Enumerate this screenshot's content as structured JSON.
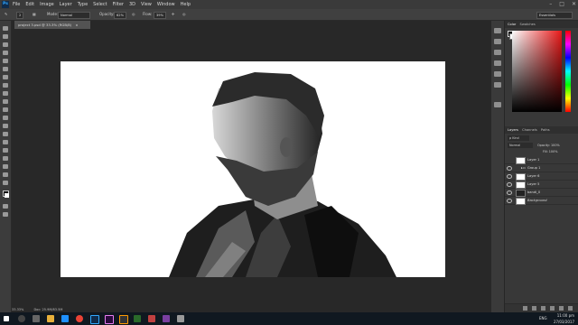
{
  "app": {
    "logo": "Ps"
  },
  "menu": [
    "File",
    "Edit",
    "Image",
    "Layer",
    "Type",
    "Select",
    "Filter",
    "3D",
    "View",
    "Window",
    "Help"
  ],
  "window_controls": [
    "–",
    "□",
    "✕"
  ],
  "options_bar": {
    "brush_size": "2",
    "mode_label": "Mode:",
    "mode_value": "Normal",
    "opacity_label": "Opacity:",
    "opacity_value": "62%",
    "flow_label": "Flow:",
    "flow_value": "39%",
    "workspace": "Essentials"
  },
  "document_tab": {
    "title": "project 3.psd @ 33.3% (RGB/8)",
    "close": "×"
  },
  "panels": {
    "color_tabs": [
      "Color",
      "Swatches"
    ],
    "layers_tabs": [
      "Layers",
      "Channels",
      "Paths"
    ],
    "layers_filter": "ρ Kind",
    "layers_mode": "Normal",
    "layers_opacity_label": "Opacity:",
    "layers_opacity": "100%",
    "layers_fill_label": "Fill:",
    "layers_fill": "100%",
    "layers": [
      {
        "name": "Layer 1"
      },
      {
        "name": "Group 1"
      },
      {
        "name": "Layer 6"
      },
      {
        "name": "Layer 5"
      },
      {
        "name": "bandi_0"
      },
      {
        "name": "Background"
      }
    ]
  },
  "status_bar": {
    "zoom": "33.33%",
    "doc": "Doc: 25.9M/83.5M"
  },
  "taskbar": {
    "language": "ENG",
    "time": "11:00 pm",
    "date": "27/03/2017"
  },
  "colors": {
    "accent": "#31a8ff",
    "canvas": "#ffffff",
    "workspace": "#282828"
  }
}
